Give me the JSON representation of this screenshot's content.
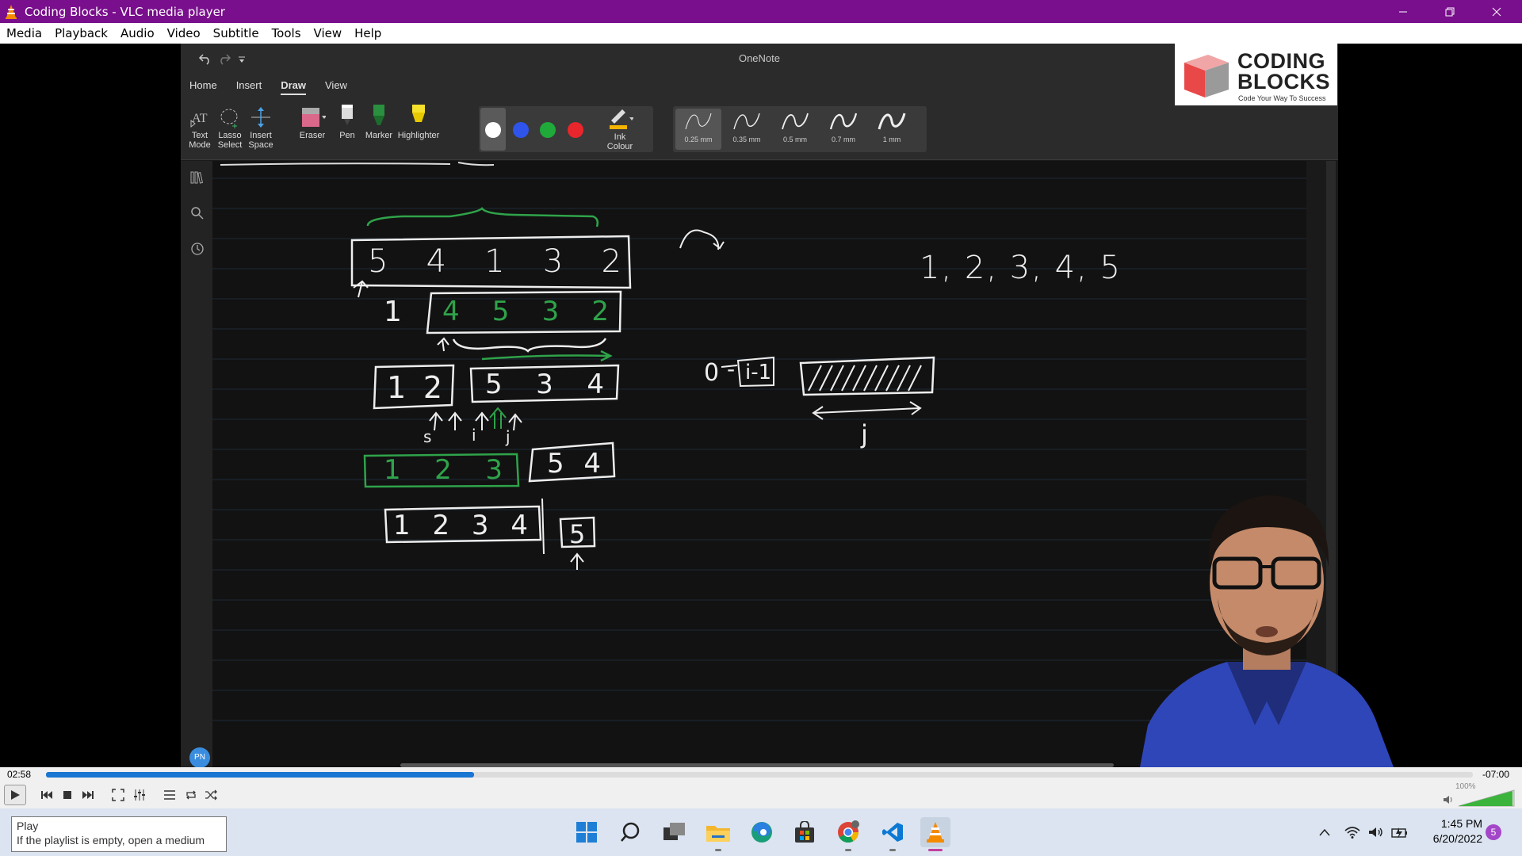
{
  "window": {
    "title": "Coding Blocks - VLC media player"
  },
  "menu": [
    "Media",
    "Playback",
    "Audio",
    "Video",
    "Subtitle",
    "Tools",
    "View",
    "Help"
  ],
  "onenote": {
    "title": "OneNote",
    "tabs": [
      "Home",
      "Insert",
      "Draw",
      "View"
    ],
    "active_tab": "Draw",
    "tools": {
      "text_mode": "Text Mode",
      "lasso": "Lasso Select",
      "insert_space": "Insert Space",
      "eraser": "Eraser",
      "pen": "Pen",
      "marker": "Marker",
      "highlighter": "Highlighter",
      "ink_colour": "Ink Colour"
    },
    "ink_colors": [
      "#ffffff",
      "#2f54eb",
      "#1faa3a",
      "#e8262c"
    ],
    "pen_sizes": [
      "0.25 mm",
      "0.35 mm",
      "0.5 mm",
      "0.7 mm",
      "1 mm"
    ],
    "avatar": "PN"
  },
  "logo": {
    "line1": "CODING",
    "line2": "BLOCKS",
    "tagline": "Code Your Way To Success"
  },
  "whiteboard": {
    "array_top": [
      "5",
      "4",
      "1",
      "3",
      "2"
    ],
    "sorted_note": "1, 2, 3, 4, 5",
    "row2": {
      "left": "1",
      "box": [
        "4",
        "5",
        "3",
        "2"
      ]
    },
    "row3": {
      "left": [
        "1",
        "2"
      ],
      "right": [
        "5",
        "3",
        "4"
      ],
      "ptr_labels": [
        "s",
        "i",
        "j"
      ]
    },
    "row4": {
      "left": [
        "1",
        "2",
        "3"
      ],
      "right": [
        "5",
        "4"
      ]
    },
    "row5": {
      "left": [
        "1",
        "2",
        "3",
        "4"
      ],
      "right": [
        "5"
      ]
    },
    "range_note": {
      "zero": "0",
      "dash": "-",
      "i_minus_1": "i-1",
      "j": "j"
    }
  },
  "player": {
    "elapsed": "02:58",
    "remaining": "-07:00",
    "progress": 0.3,
    "volume": "100%"
  },
  "tooltip": {
    "title": "Play",
    "message": "If the playlist is empty, open a medium"
  },
  "clock": {
    "time": "1:45 PM",
    "date": "6/20/2022"
  },
  "notifications": "5"
}
